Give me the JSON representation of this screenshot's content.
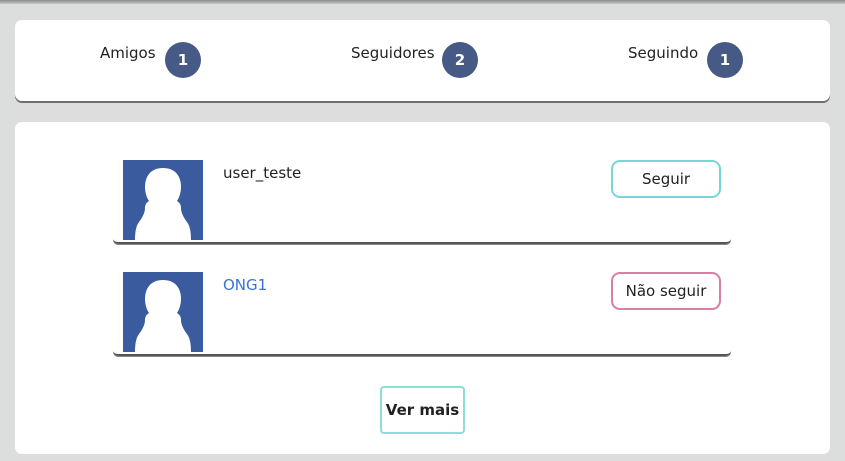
{
  "stats": {
    "friends": {
      "label": "Amigos",
      "count": "1"
    },
    "followers": {
      "label": "Seguidores",
      "count": "2"
    },
    "following": {
      "label": "Seguindo",
      "count": "1"
    }
  },
  "users": [
    {
      "name": "user_teste",
      "name_color": "#222222",
      "action": "Seguir",
      "action_border": "#79d6d6"
    },
    {
      "name": "ONG1",
      "name_color": "#3a73d6",
      "action": "Não seguir",
      "action_border": "#d97fa5"
    }
  ],
  "more_button": {
    "label": "Ver mais"
  },
  "colors": {
    "badge": "#475a85",
    "avatar": "#3a5c9f",
    "page_background": "#dcdedd"
  },
  "icons": {
    "avatar": "user-silhouette-icon"
  }
}
